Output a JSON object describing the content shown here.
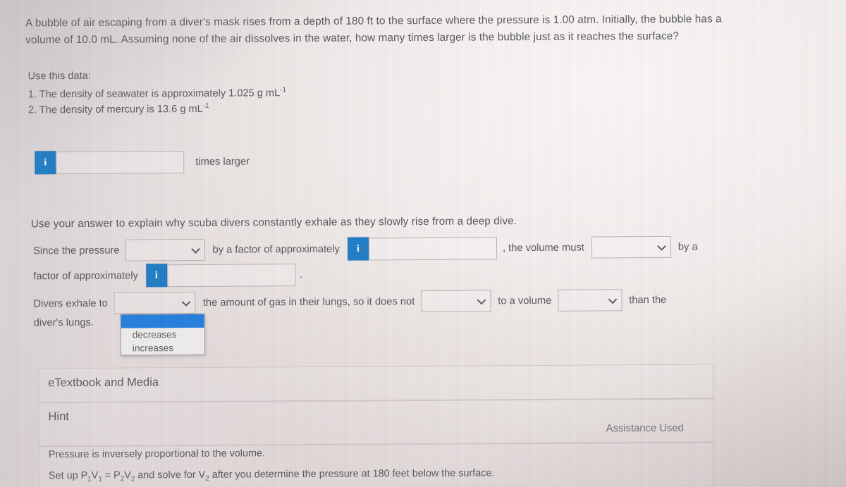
{
  "question": {
    "paragraph": "A bubble of air escaping from a diver's mask rises from a depth of 180 ft to the surface where the pressure is 1.00 atm. Initially, the bubble has a volume of 10.0 mL. Assuming none of the air dissolves in the water, how many times larger is the bubble just as it reaches the surface?",
    "data_heading": "Use this data:",
    "data_item_1_pre": "1. The density of seawater is approximately 1.025 g mL",
    "data_item_1_sup": "-1",
    "data_item_2_pre": "2. The density of mercury is 13.6 g mL",
    "data_item_2_sup": "-1"
  },
  "answer": {
    "info_icon_label": "i",
    "input_value": "",
    "unit_label": "times larger"
  },
  "explanation": {
    "prompt": "Use your answer to explain why scuba divers constantly exhale as they slowly rise from a deep dive.",
    "line1_a": "Since the pressure",
    "line1_dropdown_value": "",
    "line1_b": "by a factor of approximately",
    "line1_info_icon_label": "i",
    "line1_input_value": "",
    "line1_c": ", the volume must",
    "line1_dropdown2_value": "",
    "line1_d": "by a",
    "line2_a": "factor of approximately",
    "line2_info_icon_label": "i",
    "line2_input_value": "",
    "line2_period": ".",
    "line3_a": "Divers exhale to",
    "line3_dropdown_value": "",
    "line3_b": "the amount of gas in their lungs, so it does not",
    "line3_dropdown2_value": "",
    "line3_c": "to a volume",
    "line3_dropdown3_value": "",
    "line3_d": "than the",
    "line4_a": "diver's lungs.",
    "open_dropdown": {
      "options": [
        "",
        "decreases",
        "increases"
      ],
      "highlighted_index": 0
    }
  },
  "panels": {
    "etextbook_title": "eTextbook and Media",
    "hint_title": "Hint",
    "assistance_used": "Assistance Used",
    "hint_line1": "Pressure is inversely proportional to the volume.",
    "hint_line2_a": "Set up P",
    "hint_line2_sub1": "1",
    "hint_line2_b": "V",
    "hint_line2_sub2": "1",
    "hint_line2_c": " = P",
    "hint_line2_sub3": "2",
    "hint_line2_d": "V",
    "hint_line2_sub4": "2",
    "hint_line2_e": " and solve for V",
    "hint_line2_sub5": "2",
    "hint_line2_f": " after you determine the pressure at 180 feet below the surface."
  },
  "colors": {
    "accent_blue": "#1b7ac4",
    "highlight_blue": "#1f7ddc",
    "text": "#54545a",
    "border": "#b9b0b2"
  }
}
